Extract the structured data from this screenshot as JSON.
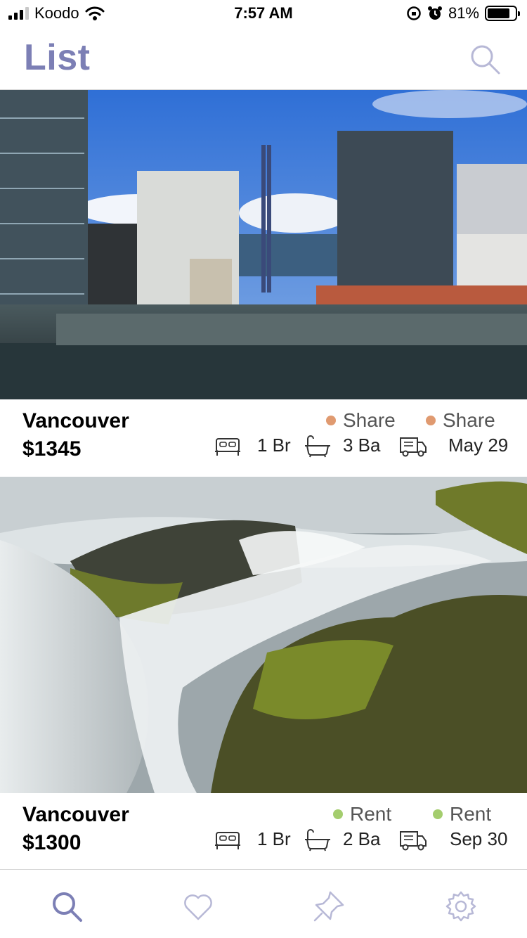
{
  "status_bar": {
    "carrier": "Koodo",
    "time": "7:57 AM",
    "battery": "81%",
    "battery_level": 0.81
  },
  "header": {
    "title": "List",
    "search_icon": "search-icon"
  },
  "colors": {
    "accent": "#7c7fb5",
    "share_dot": "#e09a70",
    "rent_dot": "#a4cd6e"
  },
  "listings": [
    {
      "city": "Vancouver",
      "price": "$1345",
      "tag1": "Share",
      "tag2": "Share",
      "bedrooms": "1 Br",
      "bathrooms": "3 Ba",
      "move_date": "May 29",
      "image": "city-skyline-photo"
    },
    {
      "city": "Vancouver",
      "price": "$1300",
      "tag1": "Rent",
      "tag2": "Rent",
      "bedrooms": "1 Br",
      "bathrooms": "2 Ba",
      "move_date": "Sep 30",
      "image": "waterfall-photo"
    }
  ],
  "tabbar": {
    "items": [
      "search-icon",
      "heart-icon",
      "pin-icon",
      "gear-icon"
    ]
  }
}
